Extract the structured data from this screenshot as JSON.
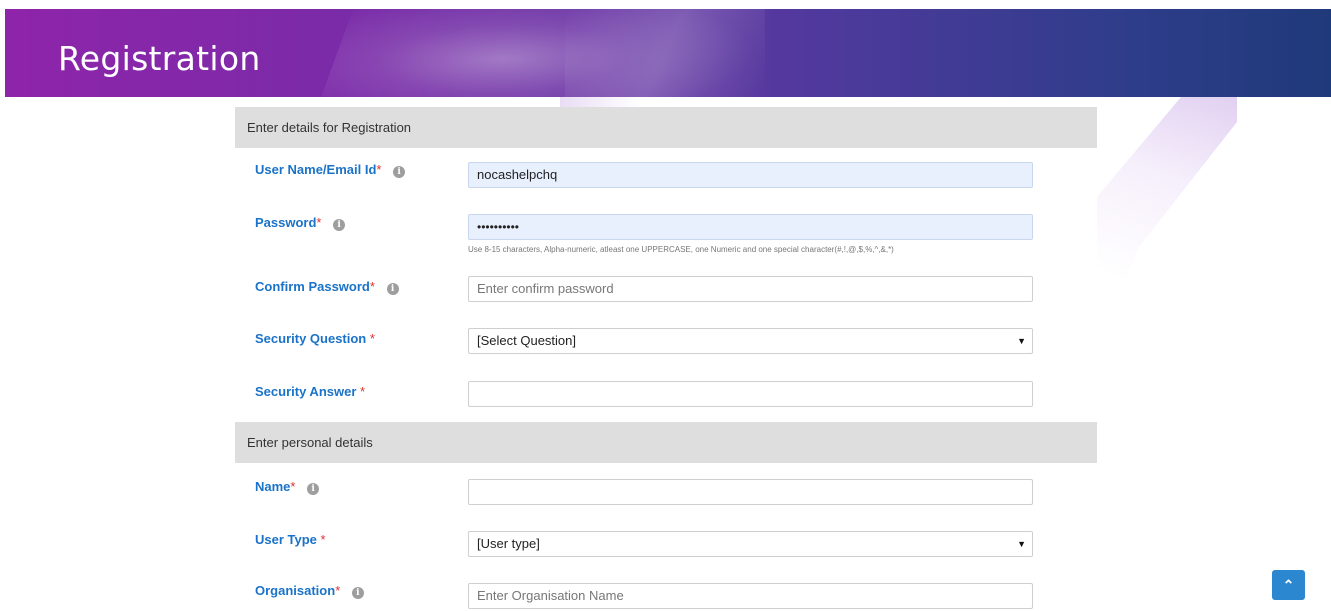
{
  "header": {
    "title": "Registration"
  },
  "sections": {
    "registration": {
      "title": "Enter details for Registration"
    },
    "personal": {
      "title": "Enter personal details"
    }
  },
  "fields": {
    "username": {
      "label": "User Name/Email Id",
      "value": "nocashelpchq"
    },
    "password": {
      "label": "Password",
      "value": "••••••••••",
      "hint": "Use 8-15 characters, Alpha-numeric, atleast one UPPERCASE, one Numeric and one special character(#,!,@,$,%,^,&,*)"
    },
    "confirm_password": {
      "label": "Confirm Password",
      "placeholder": "Enter confirm password"
    },
    "security_question": {
      "label": "Security Question",
      "selected": "[Select Question]"
    },
    "security_answer": {
      "label": "Security Answer",
      "value": ""
    },
    "name": {
      "label": "Name",
      "value": ""
    },
    "user_type": {
      "label": "User Type",
      "selected": "[User type]"
    },
    "organisation": {
      "label": "Organisation",
      "placeholder": "Enter Organisation Name"
    }
  },
  "required_marker": "*",
  "icons": {
    "info": "info-icon",
    "dropdown": "caret-down-icon",
    "scroll_top": "chevron-up-icon"
  },
  "glyphs": {
    "info": "i",
    "caret": "▼",
    "up": "⌃"
  },
  "colors": {
    "label": "#1a73c8",
    "required": "#e03030",
    "accent": "#2a87d0"
  }
}
